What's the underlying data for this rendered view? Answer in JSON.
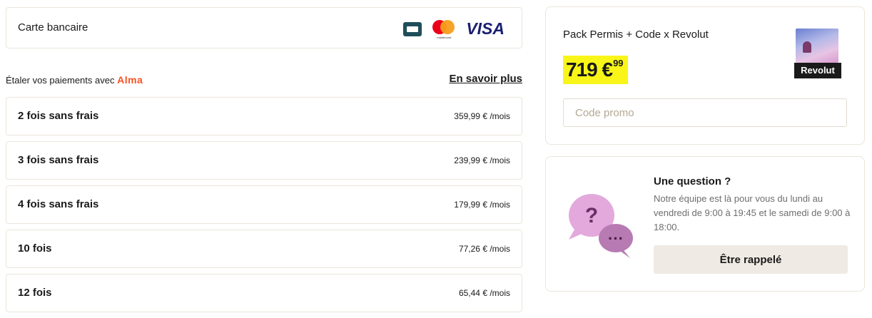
{
  "payment": {
    "method_label": "Carte bancaire",
    "card_logos": [
      "cb-icon",
      "mastercard-icon",
      "visa-icon"
    ],
    "mastercard_text": "mastercard",
    "visa_text": "VISA"
  },
  "alma": {
    "prefix": "Étaler vos paiements avec",
    "brand": "Alma",
    "learn_more": "En savoir plus"
  },
  "installments": [
    {
      "label": "2 fois sans frais",
      "price": "359,99 € /mois"
    },
    {
      "label": "3 fois sans frais",
      "price": "239,99 € /mois"
    },
    {
      "label": "4 fois sans frais",
      "price": "179,99 € /mois"
    },
    {
      "label": "10 fois",
      "price": "77,26 € /mois"
    },
    {
      "label": "12 fois",
      "price": "65,44 € /mois"
    }
  ],
  "order": {
    "product_name": "Pack Permis + Code x Revolut",
    "price_main": "719 €",
    "price_cents": "99",
    "product_badge": "Revolut",
    "promo_placeholder": "Code promo",
    "promo_value": ""
  },
  "help": {
    "title": "Une question ?",
    "text": "Notre équipe est là pour vous du lundi au vendredi de 9:00 à 19:45 et le samedi de 9:00 à 18:00.",
    "callback_label": "Être rappelé",
    "bubble_question": "?",
    "bubble_dots": "···"
  },
  "colors": {
    "accent_yellow": "#f9f518",
    "alma_orange": "#fa5022",
    "border": "#ebe6dc",
    "button_bg": "#efebe4",
    "bubble_purple": "#c98bc4"
  }
}
